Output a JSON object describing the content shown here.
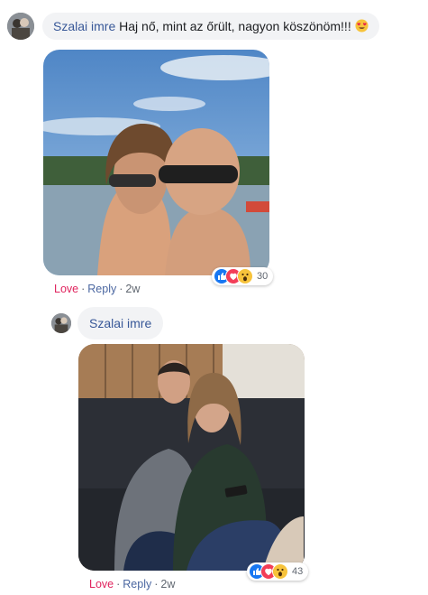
{
  "comment1": {
    "author": "Szalai imre",
    "text": "Haj nő, mint az őrült, nagyon köszönöm!!!",
    "emoji_icon": "heart-eyes-emoji",
    "actions": {
      "love": "Love",
      "reply": "Reply",
      "time": "2w"
    },
    "reaction_count": "30",
    "reactions": [
      "like",
      "love",
      "wow"
    ]
  },
  "comment2": {
    "author": "Szalai imre",
    "actions": {
      "love": "Love",
      "reply": "Reply",
      "time": "2w"
    },
    "reaction_count": "43",
    "reactions": [
      "like",
      "love",
      "wow"
    ]
  },
  "colors": {
    "author": "#385898",
    "love": "#e0245e",
    "reply": "#4b67a1",
    "bubble": "#f2f3f5",
    "like": "#1877f2"
  }
}
